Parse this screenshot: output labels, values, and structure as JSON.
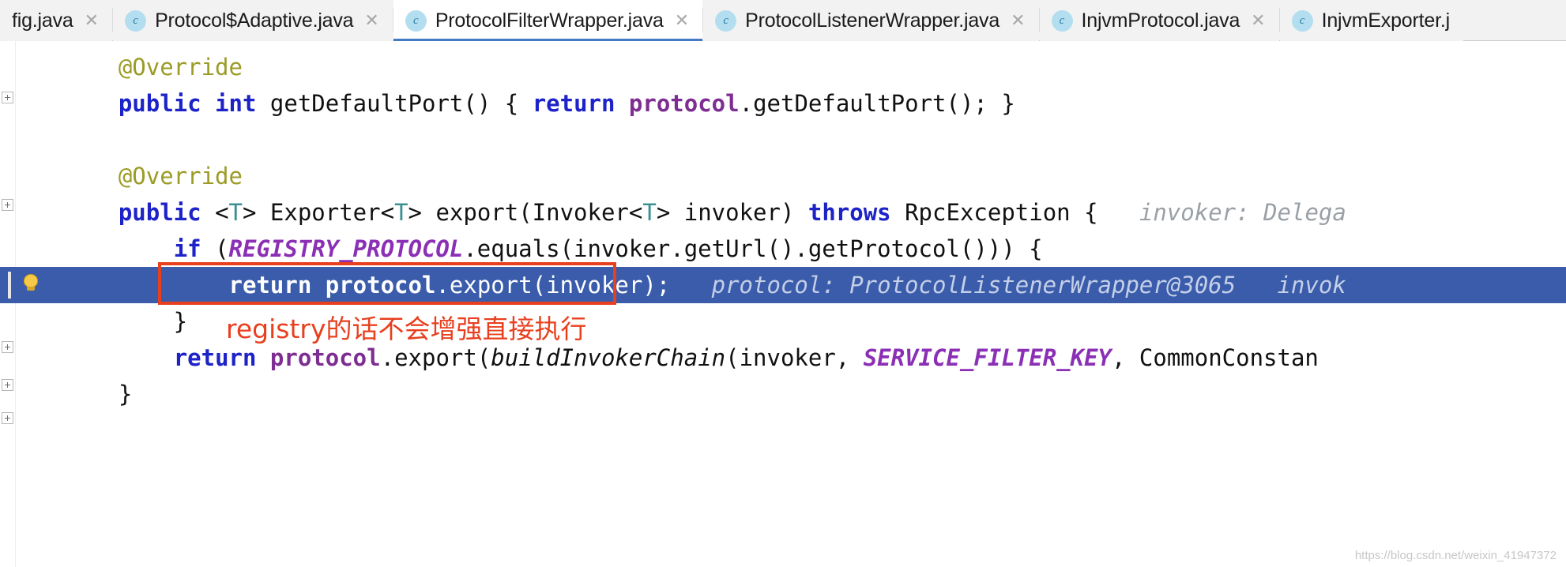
{
  "window": {
    "app": "IntelliJ IDEA editor",
    "watermark": "https://blog.csdn.net/weixin_41947372"
  },
  "colors": {
    "tab_active_underline": "#4479c4",
    "tab_icon_bg": "#b3def0",
    "selection_row_bg": "#3a5caa",
    "annotation_red": "#e8401f",
    "keyword_blue": "#1d23c8",
    "field_purple": "#7e2d92",
    "constant_purple": "#8b2fb5",
    "annotation_olive": "#9b9b26",
    "generic_teal": "#3d8f93",
    "hint_gray": "#9aa0a6"
  },
  "tabs": [
    {
      "label": "fig.java",
      "icon": "",
      "icon_letter": "",
      "has_icon": false,
      "selected": false,
      "close": "✕"
    },
    {
      "label": "Protocol$Adaptive.java",
      "icon": "java-class-icon",
      "icon_letter": "c",
      "has_icon": true,
      "selected": false,
      "close": "✕"
    },
    {
      "label": "ProtocolFilterWrapper.java",
      "icon": "java-class-icon",
      "icon_letter": "c",
      "has_icon": true,
      "selected": true,
      "close": "✕"
    },
    {
      "label": "ProtocolListenerWrapper.java",
      "icon": "java-class-icon",
      "icon_letter": "c",
      "has_icon": true,
      "selected": false,
      "close": "✕"
    },
    {
      "label": "InjvmProtocol.java",
      "icon": "java-class-icon",
      "icon_letter": "c",
      "has_icon": true,
      "selected": false,
      "close": "✕"
    },
    {
      "label": "InjvmExporter.j",
      "icon": "java-class-icon",
      "icon_letter": "c",
      "has_icon": true,
      "selected": false,
      "close": ""
    }
  ],
  "code": {
    "language": "java",
    "annotation_note": "registry的话不会增强直接执行",
    "lines": [
      {
        "id": "line-override-1",
        "text": "    @Override",
        "tokens": [
          {
            "t": "    ",
            "c": "pln"
          },
          {
            "t": "@Override",
            "c": "anno"
          }
        ]
      },
      {
        "id": "line-getdefaultport",
        "text": "    public int getDefaultPort() { return protocol.getDefaultPort(); }",
        "tokens": [
          {
            "t": "    ",
            "c": "pln"
          },
          {
            "t": "public",
            "c": "kw"
          },
          {
            "t": " ",
            "c": "pln"
          },
          {
            "t": "int",
            "c": "kw"
          },
          {
            "t": " getDefaultPort() ",
            "c": "pln"
          },
          {
            "t": "{",
            "c": "pln"
          },
          {
            "t": " ",
            "c": "pln"
          },
          {
            "t": "return",
            "c": "kw"
          },
          {
            "t": " ",
            "c": "pln"
          },
          {
            "t": "protocol",
            "c": "fld"
          },
          {
            "t": ".getDefaultPort(); ",
            "c": "pln"
          },
          {
            "t": "}",
            "c": "pln"
          }
        ]
      },
      {
        "id": "line-blank-1",
        "text": "",
        "tokens": []
      },
      {
        "id": "line-override-2",
        "text": "    @Override",
        "tokens": [
          {
            "t": "    ",
            "c": "pln"
          },
          {
            "t": "@Override",
            "c": "anno"
          }
        ]
      },
      {
        "id": "line-export-signature",
        "text": "    public <T> Exporter<T> export(Invoker<T> invoker) throws RpcException {   invoker: Delega",
        "tokens": [
          {
            "t": "    ",
            "c": "pln"
          },
          {
            "t": "public",
            "c": "kw"
          },
          {
            "t": " <",
            "c": "pln"
          },
          {
            "t": "T",
            "c": "gen"
          },
          {
            "t": "> Exporter<",
            "c": "pln"
          },
          {
            "t": "T",
            "c": "gen"
          },
          {
            "t": "> export(Invoker<",
            "c": "pln"
          },
          {
            "t": "T",
            "c": "gen"
          },
          {
            "t": "> invoker) ",
            "c": "pln"
          },
          {
            "t": "throws",
            "c": "kw"
          },
          {
            "t": " RpcException {",
            "c": "pln"
          },
          {
            "t": "   invoker: Delega",
            "c": "hintmut"
          }
        ]
      },
      {
        "id": "line-if-registry",
        "text": "        if (REGISTRY_PROTOCOL.equals(invoker.getUrl().getProtocol())) {",
        "tokens": [
          {
            "t": "        ",
            "c": "pln"
          },
          {
            "t": "if",
            "c": "kw"
          },
          {
            "t": " (",
            "c": "pln"
          },
          {
            "t": "REGISTRY_PROTOCOL",
            "c": "cst"
          },
          {
            "t": ".equals(invoker.getUrl().getProtocol())) {",
            "c": "pln"
          }
        ]
      },
      {
        "id": "line-return-export-invoker",
        "highlighted": true,
        "text": "            return protocol.export(invoker);   protocol: ProtocolListenerWrapper@3065   invok",
        "tokens": [
          {
            "t": "            ",
            "c": "pln"
          },
          {
            "t": "return",
            "c": "kw"
          },
          {
            "t": " ",
            "c": "pln"
          },
          {
            "t": "protocol",
            "c": "fld"
          },
          {
            "t": ".export(invoker);",
            "c": "pln"
          },
          {
            "t": "   protocol: ProtocolListenerWrapper@3065   invok",
            "c": "hintmut"
          }
        ]
      },
      {
        "id": "line-close-if",
        "text": "        }",
        "tokens": [
          {
            "t": "        }",
            "c": "pln"
          }
        ]
      },
      {
        "id": "line-return-buildinvokerchain",
        "text": "        return protocol.export(buildInvokerChain(invoker, SERVICE_FILTER_KEY, CommonConstan",
        "tokens": [
          {
            "t": "        ",
            "c": "pln"
          },
          {
            "t": "return",
            "c": "kw"
          },
          {
            "t": " ",
            "c": "pln"
          },
          {
            "t": "protocol",
            "c": "fld"
          },
          {
            "t": ".export(",
            "c": "pln"
          },
          {
            "t": "buildInvokerChain",
            "c": "itl"
          },
          {
            "t": "(invoker, ",
            "c": "pln"
          },
          {
            "t": "SERVICE_FILTER_KEY",
            "c": "cst"
          },
          {
            "t": ", CommonConstan",
            "c": "pln"
          }
        ]
      },
      {
        "id": "line-close-method",
        "text": "    }",
        "tokens": [
          {
            "t": "    }",
            "c": "pln"
          }
        ]
      }
    ]
  },
  "gutter": {
    "fold_markers": 5
  }
}
